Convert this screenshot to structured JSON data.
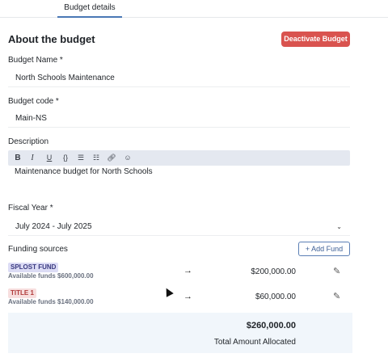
{
  "tabs": {
    "active_label": "Budget details"
  },
  "header": {
    "title": "About the budget",
    "deactivate_label": "Deactivate Budget"
  },
  "form": {
    "budget_name": {
      "label": "Budget Name *",
      "value": "North Schools Maintenance"
    },
    "budget_code": {
      "label": "Budget code *",
      "value": "Main-NS"
    },
    "description": {
      "label": "Description",
      "toolbar": [
        "bold-icon",
        "italic-icon",
        "underline-icon",
        "code-icon",
        "bullet-list-icon",
        "numbered-list-icon",
        "link-icon",
        "emoji-icon"
      ],
      "value": "Maintenance budget for North Schools"
    },
    "fiscal_year": {
      "label": "Fiscal Year *",
      "value": "July 2024 - July 2025"
    }
  },
  "funding": {
    "label": "Funding sources",
    "add_label": "+ Add Fund",
    "items": [
      {
        "name": "SPLOST FUND",
        "available": "Available funds $600,000.00",
        "amount": "$200,000.00"
      },
      {
        "name": "TITLE 1",
        "available": "Available funds $140,000.00",
        "amount": "$60,000.00"
      }
    ],
    "total_amount": "$260,000.00",
    "total_label": "Total Amount Allocated"
  },
  "colors": {
    "danger": "#d9534f",
    "accent": "#4a78b5",
    "toolbar_bg": "#e4e8f0",
    "total_bg": "#f1f6fb"
  }
}
